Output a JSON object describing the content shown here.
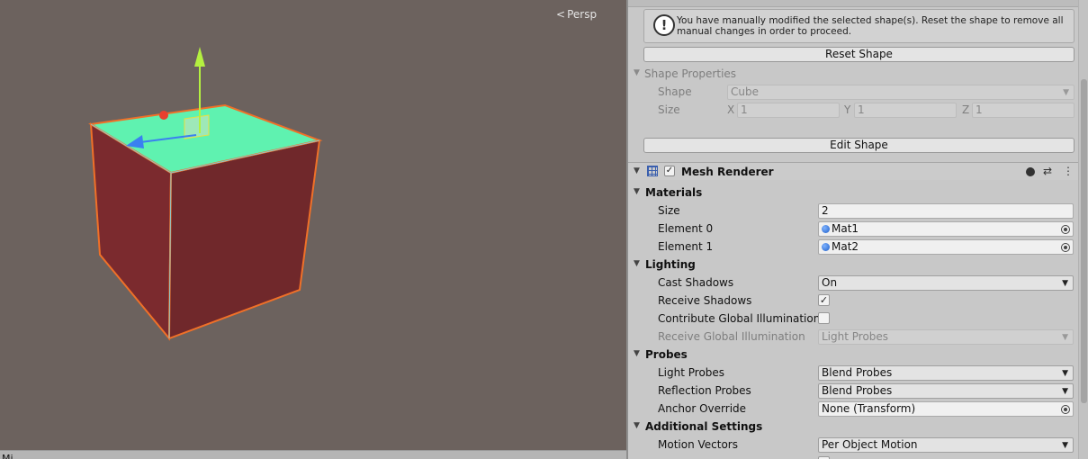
{
  "scene": {
    "persp_label": "Persp",
    "bottom_label": "Mi",
    "colors": {
      "background": "#6c625e",
      "cube_top": "#5ff2b0",
      "cube_front": "#7b2a2e",
      "cube_side": "#70282b",
      "outline": "#f07028",
      "y_axis": "#b4f040",
      "z_axis": "#3a80f0",
      "x_axis": "#e84030"
    }
  },
  "help_box": {
    "icon": "warning-exclamation-icon",
    "text": "You have manually modified the selected shape(s). Reset the shape to remove all manual changes in order to proceed."
  },
  "reset_button": "Reset Shape",
  "shape_properties": {
    "header": "Shape Properties",
    "shape_label": "Shape",
    "shape_value": "Cube",
    "size_label": "Size",
    "x_label": "X",
    "x_value": "1",
    "y_label": "Y",
    "y_value": "1",
    "z_label": "Z",
    "z_value": "1"
  },
  "edit_button": "Edit Shape",
  "mesh_renderer": {
    "title": "Mesh Renderer",
    "enabled": true,
    "icons": [
      "help-icon",
      "presets-icon",
      "more-menu-icon"
    ],
    "materials": {
      "header": "Materials",
      "size_label": "Size",
      "size_value": "2",
      "element0_label": "Element 0",
      "element0_value": "Mat1",
      "element1_label": "Element 1",
      "element1_value": "Mat2"
    },
    "lighting": {
      "header": "Lighting",
      "cast_shadows_label": "Cast Shadows",
      "cast_shadows_value": "On",
      "receive_shadows_label": "Receive Shadows",
      "receive_shadows_checked": true,
      "contribute_gi_label": "Contribute Global Illumination",
      "contribute_gi_checked": false,
      "receive_gi_label": "Receive Global Illumination",
      "receive_gi_value": "Light Probes"
    },
    "probes": {
      "header": "Probes",
      "light_probes_label": "Light Probes",
      "light_probes_value": "Blend Probes",
      "reflection_probes_label": "Reflection Probes",
      "reflection_probes_value": "Blend Probes",
      "anchor_override_label": "Anchor Override",
      "anchor_override_value": "None (Transform)"
    },
    "additional": {
      "header": "Additional Settings",
      "motion_vectors_label": "Motion Vectors",
      "motion_vectors_value": "Per Object Motion"
    }
  }
}
